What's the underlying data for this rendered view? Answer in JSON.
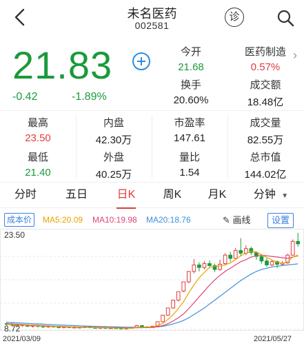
{
  "header": {
    "title": "未名医药",
    "code": "002581",
    "diagnose_label": "诊"
  },
  "quote": {
    "price": "21.83",
    "change": "-0.42",
    "change_pct": "-1.89%",
    "open": {
      "label": "今开",
      "value": "21.68"
    },
    "sector": {
      "label": "医药制造",
      "value": "0.57%"
    },
    "turnover": {
      "label": "换手",
      "value": "20.60%"
    },
    "amount": {
      "label": "成交额",
      "value": "18.48亿"
    }
  },
  "stats": {
    "high": {
      "label": "最高",
      "value": "23.50"
    },
    "inner": {
      "label": "内盘",
      "value": "42.30万"
    },
    "pe": {
      "label": "市盈率",
      "value": "147.61"
    },
    "volume": {
      "label": "成交量",
      "value": "82.55万"
    },
    "low": {
      "label": "最低",
      "value": "21.40"
    },
    "outer": {
      "label": "外盘",
      "value": "40.25万"
    },
    "vol_ratio": {
      "label": "量比",
      "value": "1.54"
    },
    "market_cap": {
      "label": "总市值",
      "value": "144.02亿"
    }
  },
  "tabs": [
    "分时",
    "五日",
    "日K",
    "周K",
    "月K",
    "分钟"
  ],
  "toolbar": {
    "cost_label": "成本价",
    "ma5": "MA5:20.09",
    "ma10": "MA10:19.98",
    "ma20": "MA20:18.76",
    "draw_label": "画线",
    "settings_label": "设置"
  },
  "colors": {
    "up": "#e23b3b",
    "down": "#1a9a3a",
    "ma5": "#e8a200",
    "ma10": "#e0447a",
    "ma20": "#3b8fd8",
    "accent": "#3b7fe0"
  },
  "chart_data": {
    "type": "candlestick",
    "y_max_label": "23.50",
    "y_min_label": "8.72",
    "x_start_label": "2021/03/09",
    "x_end_label": "2021/05/27",
    "ylim": [
      8.72,
      23.5
    ],
    "candles": [
      [
        9.6,
        9.5,
        9.9,
        9.3
      ],
      [
        9.5,
        9.4,
        9.7,
        9.2
      ],
      [
        9.4,
        9.3,
        9.6,
        9.1
      ],
      [
        9.3,
        9.4,
        9.5,
        9.1
      ],
      [
        9.4,
        9.2,
        9.5,
        9.1
      ],
      [
        9.2,
        9.3,
        9.4,
        9.0
      ],
      [
        9.3,
        9.2,
        9.4,
        9.0
      ],
      [
        9.2,
        9.1,
        9.3,
        8.95
      ],
      [
        9.1,
        9.2,
        9.3,
        8.95
      ],
      [
        9.2,
        9.1,
        9.3,
        9.0
      ],
      [
        9.1,
        9.0,
        9.2,
        8.9
      ],
      [
        9.0,
        9.1,
        9.2,
        8.9
      ],
      [
        9.1,
        9.0,
        9.2,
        8.9
      ],
      [
        9.0,
        9.05,
        9.15,
        8.9
      ],
      [
        9.05,
        9.0,
        9.1,
        8.9
      ],
      [
        9.0,
        9.1,
        9.2,
        8.95
      ],
      [
        9.1,
        9.0,
        9.2,
        8.9
      ],
      [
        9.0,
        8.95,
        9.1,
        8.85
      ],
      [
        8.95,
        9.0,
        9.1,
        8.85
      ],
      [
        9.0,
        8.9,
        9.05,
        8.8
      ],
      [
        8.9,
        8.95,
        9.05,
        8.8
      ],
      [
        8.95,
        8.9,
        9.0,
        8.8
      ],
      [
        8.9,
        8.85,
        9.0,
        8.75
      ],
      [
        8.85,
        8.9,
        9.0,
        8.72
      ],
      [
        8.9,
        9.0,
        9.1,
        8.8
      ],
      [
        9.0,
        9.3,
        9.4,
        8.95
      ],
      [
        9.3,
        9.1,
        9.35,
        9.0
      ],
      [
        9.1,
        9.0,
        9.2,
        8.9
      ],
      [
        9.0,
        9.2,
        9.3,
        8.95
      ],
      [
        9.2,
        9.9,
        9.9,
        9.15
      ],
      [
        9.9,
        10.9,
        10.9,
        9.8
      ],
      [
        10.9,
        12.0,
        12.0,
        10.8
      ],
      [
        12.0,
        13.2,
        13.2,
        11.9
      ],
      [
        13.2,
        14.5,
        14.5,
        13.0
      ],
      [
        14.6,
        16.0,
        16.0,
        14.4
      ],
      [
        16.0,
        17.6,
        17.6,
        15.8
      ],
      [
        17.6,
        18.6,
        19.5,
        17.3
      ],
      [
        18.6,
        18.2,
        19.0,
        17.6
      ],
      [
        18.2,
        18.8,
        19.2,
        17.9
      ],
      [
        18.8,
        18.5,
        19.3,
        18.1
      ],
      [
        18.5,
        17.9,
        18.8,
        17.5
      ],
      [
        17.9,
        18.7,
        19.4,
        17.7
      ],
      [
        18.8,
        20.1,
        20.4,
        18.6
      ],
      [
        20.1,
        19.6,
        20.6,
        19.1
      ],
      [
        19.6,
        20.8,
        21.2,
        19.5
      ],
      [
        20.8,
        20.4,
        22.7,
        20.0
      ],
      [
        20.4,
        21.1,
        21.6,
        20.1
      ],
      [
        21.1,
        20.5,
        21.4,
        20.1
      ],
      [
        20.5,
        19.9,
        20.7,
        19.4
      ],
      [
        19.9,
        19.2,
        20.1,
        18.8
      ],
      [
        19.2,
        18.6,
        19.6,
        18.3
      ],
      [
        18.6,
        19.1,
        19.4,
        18.4
      ],
      [
        19.1,
        18.7,
        19.3,
        18.1
      ],
      [
        18.7,
        18.9,
        19.2,
        18.5
      ],
      [
        18.9,
        20.1,
        20.3,
        18.8
      ],
      [
        20.1,
        22.2,
        22.5,
        20.0
      ],
      [
        22.2,
        21.83,
        23.5,
        21.4
      ]
    ],
    "ma5": [
      9.5,
      9.45,
      9.4,
      9.38,
      9.36,
      9.32,
      9.28,
      9.24,
      9.2,
      9.18,
      9.14,
      9.1,
      9.08,
      9.06,
      9.04,
      9.03,
      9.02,
      9.01,
      9.0,
      8.98,
      8.96,
      8.94,
      8.92,
      8.9,
      8.92,
      9.0,
      9.04,
      9.06,
      9.12,
      9.3,
      9.64,
      10.24,
      10.98,
      11.9,
      12.98,
      14.3,
      15.54,
      16.64,
      17.44,
      18.22,
      18.4,
      18.42,
      18.6,
      18.92,
      19.4,
      20.0,
      20.4,
      20.7,
      20.54,
      20.2,
      19.72,
      19.36,
      19.02,
      18.86,
      19.06,
      19.82,
      20.09
    ],
    "ma10": [
      9.6,
      9.55,
      9.5,
      9.46,
      9.42,
      9.38,
      9.34,
      9.3,
      9.26,
      9.22,
      9.18,
      9.15,
      9.12,
      9.1,
      9.08,
      9.06,
      9.05,
      9.04,
      9.02,
      9.0,
      8.99,
      8.98,
      8.96,
      8.95,
      8.94,
      8.96,
      8.98,
      9.0,
      9.04,
      9.12,
      9.3,
      9.6,
      10.0,
      10.5,
      11.1,
      11.9,
      12.8,
      13.7,
      14.6,
      15.5,
      16.3,
      17.0,
      17.6,
      18.1,
      18.6,
      19.1,
      19.4,
      19.8,
      20.0,
      20.1,
      20.0,
      19.9,
      19.8,
      19.7,
      19.6,
      19.8,
      19.98
    ],
    "ma20": [
      9.8,
      9.76,
      9.72,
      9.68,
      9.64,
      9.6,
      9.56,
      9.52,
      9.48,
      9.44,
      9.4,
      9.36,
      9.33,
      9.3,
      9.27,
      9.24,
      9.21,
      9.18,
      9.16,
      9.14,
      9.12,
      9.1,
      9.08,
      9.06,
      9.05,
      9.05,
      9.05,
      9.05,
      9.07,
      9.1,
      9.2,
      9.35,
      9.55,
      9.8,
      10.1,
      10.5,
      11.0,
      11.5,
      12.0,
      12.6,
      13.2,
      13.8,
      14.4,
      15.0,
      15.6,
      16.2,
      16.7,
      17.2,
      17.6,
      17.9,
      18.1,
      18.3,
      18.4,
      18.5,
      18.6,
      18.68,
      18.76
    ]
  }
}
